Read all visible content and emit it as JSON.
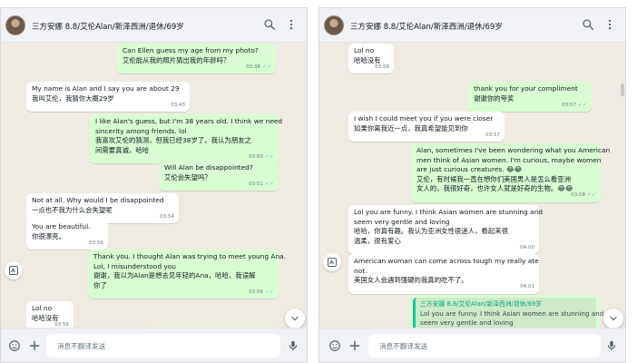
{
  "contact": {
    "name": "三方安娜 8.8/艾伦Alan/新泽西洲/退休/69岁"
  },
  "composer": {
    "placeholder": "消息不翻译发送"
  },
  "icons": {
    "search": "search-icon",
    "menu": "kebab-menu-icon",
    "emoji": "emoji-icon",
    "attach": "plus-icon",
    "mic": "microphone-icon",
    "translate": "translate-icon",
    "scroll_down": "chevron-down-icon"
  },
  "colors": {
    "incoming": "#ffffff",
    "outgoing": "#d9fdd3",
    "wallpaper": "#efeae2",
    "header": "#f0f2f5",
    "read_ticks": "#53bdeb",
    "quote_accent": "#06cf9c"
  },
  "left_panel": {
    "messages": [
      {
        "dir": "out",
        "lines": [
          "Can Ellen guess my age from my photo?",
          "艾伦能从我的照片猜出我的年龄吗？"
        ],
        "time": "03:38",
        "read": true
      },
      {
        "dir": "in",
        "lines": [
          "My name is Alan and I say you are about 29",
          "我叫艾伦，我猜你大概29岁"
        ],
        "time": "03:43",
        "read": false
      },
      {
        "dir": "out",
        "lines": [
          "I like Alan's guess, but I'm 38 years old. I think we need",
          "sincerity among friends. lol",
          "我喜欢艾伦的猜测，但我已经38岁了。我认为朋友之",
          "间需要真诚，哈哈"
        ],
        "time": "03:50",
        "read": true
      },
      {
        "dir": "out",
        "lines": [
          "Will Alan be disappointed?",
          "艾伦会失望吗？"
        ],
        "time": "03:51",
        "read": true
      },
      {
        "dir": "in",
        "lines": [
          "Not at all. Why would I be disappointed",
          "一点也不我为什么会失望呢"
        ],
        "time": "03:54",
        "read": false
      },
      {
        "dir": "in",
        "lines": [
          "You are beautiful.",
          "你很漂亮。"
        ],
        "time": "03:56",
        "read": false
      },
      {
        "dir": "out",
        "lines": [
          "Thank you. I thought Alan was trying to meet young Ana.",
          "Lol, I misunderstood you",
          "谢谢，我以为Alan是想去见年轻的Ana，哈哈，我误解",
          "你了"
        ],
        "time": "03:56",
        "read": true
      },
      {
        "dir": "in",
        "lines": [
          "Lol no",
          "哈哈没有"
        ],
        "time": "03:56",
        "read": false
      }
    ]
  },
  "right_panel": {
    "messages": [
      {
        "dir": "in",
        "lines": [
          "Lol no",
          "哈哈没有"
        ],
        "time": "03:56",
        "read": false
      },
      {
        "dir": "out",
        "lines": [
          "thank you for your compliment",
          "谢谢你的夸奖"
        ],
        "time": "03:57",
        "read": true
      },
      {
        "dir": "in",
        "lines": [
          "I wish I could meet you if you were closer",
          "如果你离我近一点，我真希望能见到你"
        ],
        "time": "03:57",
        "read": false
      },
      {
        "dir": "out",
        "lines": [
          "Alan, sometimes I've been wondering what you American",
          "men think of Asian women. I'm curious, maybe women",
          "are just curious creatures. 😂😂",
          "艾伦，有时候我一直在想你们美国男人是怎么看亚洲",
          "女人的，我很好奇，也许女人就是好奇的生物。😂😂"
        ],
        "time": "03:58",
        "read": true
      },
      {
        "dir": "in",
        "lines": [
          "Lol you are funny. I think Asian women are stunning and",
          "seem very gentle and loving",
          "哈哈，你真有趣。我认为亚洲女性很迷人，看起来很",
          "温柔，很有爱心"
        ],
        "time": "04:00",
        "read": false
      },
      {
        "dir": "in",
        "lines": [
          "American woman can come across tough my really ate",
          "not.",
          "美国女人会遇到强硬的我真的吃不了。"
        ],
        "time": "04:01",
        "read": false
      }
    ],
    "quote": {
      "author": "三方安娜 8.8/艾伦Alan/新泽西洲/退休/69岁",
      "lines": [
        "Lol you are funny. I think Asian women are stunning and",
        "seem very gentle and loving"
      ]
    }
  }
}
